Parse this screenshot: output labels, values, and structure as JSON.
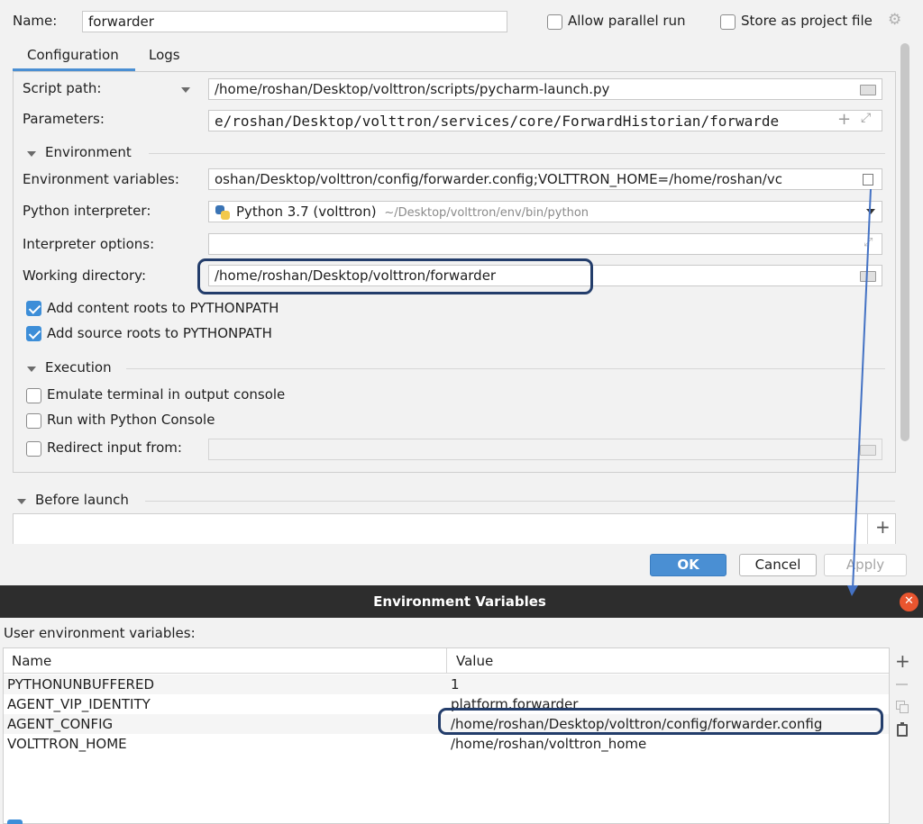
{
  "run_config": {
    "name_label": "Name:",
    "name_value": "forwarder",
    "allow_parallel_label": "Allow parallel run",
    "store_project_label": "Store as project file",
    "tabs": [
      "Configuration",
      "Logs"
    ],
    "script_path_label": "Script path:",
    "script_path_value": "/home/roshan/Desktop/volttron/scripts/pycharm-launch.py",
    "parameters_label": "Parameters:",
    "parameters_value": "e/roshan/Desktop/volttron/services/core/ForwardHistorian/forwarde",
    "environment_section": "Environment",
    "env_vars_label": "Environment variables:",
    "env_vars_value": "oshan/Desktop/volttron/config/forwarder.config;VOLTTRON_HOME=/home/roshan/vc",
    "interpreter_label": "Python interpreter:",
    "interpreter_name": "Python 3.7 (volttron)",
    "interpreter_path": "~/Desktop/volttron/env/bin/python",
    "interp_options_label": "Interpreter options:",
    "interp_options_value": "",
    "working_dir_label": "Working directory:",
    "working_dir_value": "/home/roshan/Desktop/volttron/forwarder",
    "add_content_roots_label": "Add content roots to PYTHONPATH",
    "add_content_roots_checked": true,
    "add_source_roots_label": "Add source roots to PYTHONPATH",
    "add_source_roots_checked": true,
    "execution_section": "Execution",
    "emulate_terminal_label": "Emulate terminal in output console",
    "run_python_console_label": "Run with Python Console",
    "redirect_input_label": "Redirect input from:",
    "redirect_input_value": "",
    "before_launch_label": "Before launch",
    "ok_label": "OK",
    "cancel_label": "Cancel",
    "apply_label": "Apply",
    "accent_color": "#4a8fd3"
  },
  "env_dialog": {
    "title": "Environment Variables",
    "user_vars_label": "User environment variables:",
    "columns": [
      "Name",
      "Value"
    ],
    "rows": [
      {
        "name": "PYTHONUNBUFFERED",
        "value": "1"
      },
      {
        "name": "AGENT_VIP_IDENTITY",
        "value": "platform.forwarder"
      },
      {
        "name": "AGENT_CONFIG",
        "value": "/home/roshan/Desktop/volttron/config/forwarder.config"
      },
      {
        "name": "VOLTTRON_HOME",
        "value": "/home/roshan/volttron_home"
      }
    ],
    "toolbar_icons": [
      "add-icon",
      "remove-icon",
      "copy-icon",
      "paste-icon"
    ],
    "titlebar_color": "#2d2d2d",
    "close_color": "#e9552f"
  },
  "annotation_color": "#233d6b",
  "arrow_color": "#4472c4"
}
